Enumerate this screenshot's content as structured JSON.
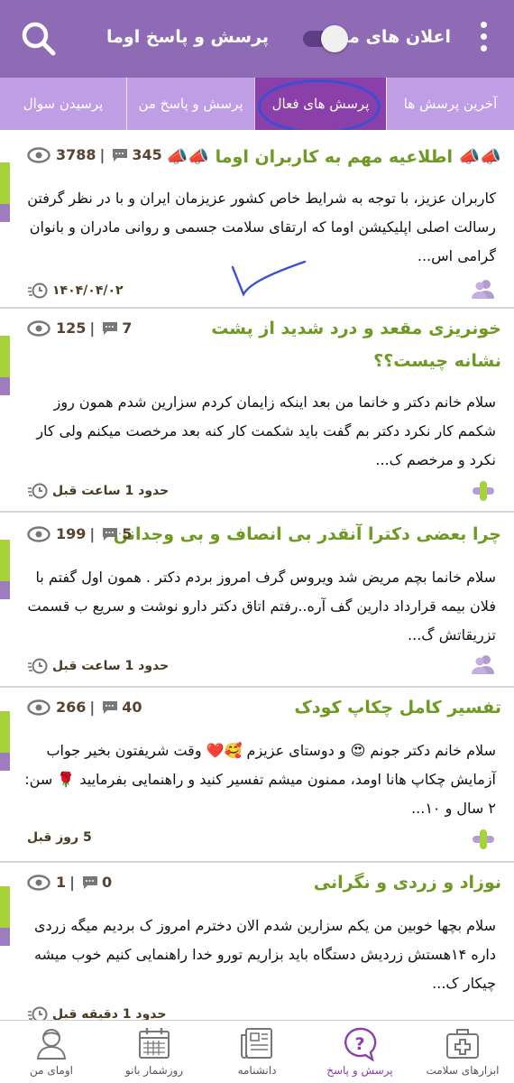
{
  "header": {
    "notifications_label": "اعلان های من",
    "app_title": "پرسش و پاسخ اوما",
    "toggle_on": false
  },
  "tabs": [
    {
      "label": "آخرین پرسش ها"
    },
    {
      "label": "پرسش های فعال",
      "active": true
    },
    {
      "label": "پرسش و پاسخ من"
    },
    {
      "label": "پرسیدن سوال"
    }
  ],
  "posts": [
    {
      "title": "📣📣 اطلاعیه مهم به کاربران اوما 📣📣",
      "answers": "345",
      "views": "3788",
      "body": "کاربران عزیز، با توجه به شرایط خاص کشور عزیزمان ایران و با در نظر گرفتن رسالت اصلی اپلیکیشن اوما که ارتقای سلامت جسمی و روانی مادران و بانوان گرامی اس...",
      "time": "۱۴۰۴/۰۴/۰۲",
      "author_icon": "users-icon"
    },
    {
      "title": "خونریزی مقعد و درد شدید از پشت نشانه چیست؟؟",
      "answers": "7",
      "views": "125",
      "body": "سلام خانم دکتر و خانما من بعد اینکه زایمان کردم سزارین شدم همون روز شکمم کار نکرد دکتر بم گفت باید شکمت کار کنه بعد مرخصت میکنم ولی کار نکرد و مرخصم ک...",
      "time": "حدود 1 ساعت قبل",
      "author_icon": "plus-icon"
    },
    {
      "title": "چرا بعضی دکترا آنقدر بی انصاف و بی وجدانن",
      "answers": "5",
      "views": "199",
      "body": "سلام خانما  بچم مریض شد ویروس گرف امروز بردم دکتر . همون اول گفتم با فلان بیمه قرارداد دارین گف آره..رفتم اتاق دکتر دارو نوشت و سریع ب قسمت تزریقاتش گ...",
      "time": "حدود 1 ساعت قبل",
      "author_icon": "users-icon"
    },
    {
      "title": "تفسیر کامل چکاپ کودک",
      "answers": "40",
      "views": "266",
      "body": "سلام خانم دکتر جونم 😍 و دوستای عزیزم 🥰❤️ وقت شریفتون بخیر جواب آزمایش چکاپ هانا اومد، ممنون میشم تفسیر کنید و راهنمایی بفرمایید 🌹 سن: ۲ سال و ۱۰...",
      "time": "5 روز قبل",
      "author_icon": "plus-icon"
    },
    {
      "title": "نوزاد و زردی و نگرانی",
      "answers": "0",
      "views": "1",
      "body": "سلام بچها خوبین  من یکم سزارین شدم  الان دخترم امروز ک بردیم میگه زردی داره ۱۴هستش زردیش  دستگاه باید بزاریم  تورو خدا راهنمایی کنیم خوب میشه چیکار ک...",
      "time": "حدود 1 دقیقه قبل",
      "author_icon": "users-icon"
    }
  ],
  "bottom_nav": [
    {
      "label": "ابزارهای سلامت",
      "icon": "medical-kit-icon"
    },
    {
      "label": "پرسش و پاسخ",
      "icon": "question-bubble-icon",
      "active": true
    },
    {
      "label": "دانشنامه",
      "icon": "newspaper-icon"
    },
    {
      "label": "روزشمار بانو",
      "icon": "calendar-icon"
    },
    {
      "label": "اومای من",
      "icon": "profile-icon"
    }
  ],
  "colors": {
    "header": "#8f6bb6",
    "tabs": "#c09ee6",
    "active_tab": "#8a3fa9",
    "title_green": "#6e9a21",
    "accent_green": "#a6d23a",
    "accent_purple": "#9d7cc0"
  }
}
